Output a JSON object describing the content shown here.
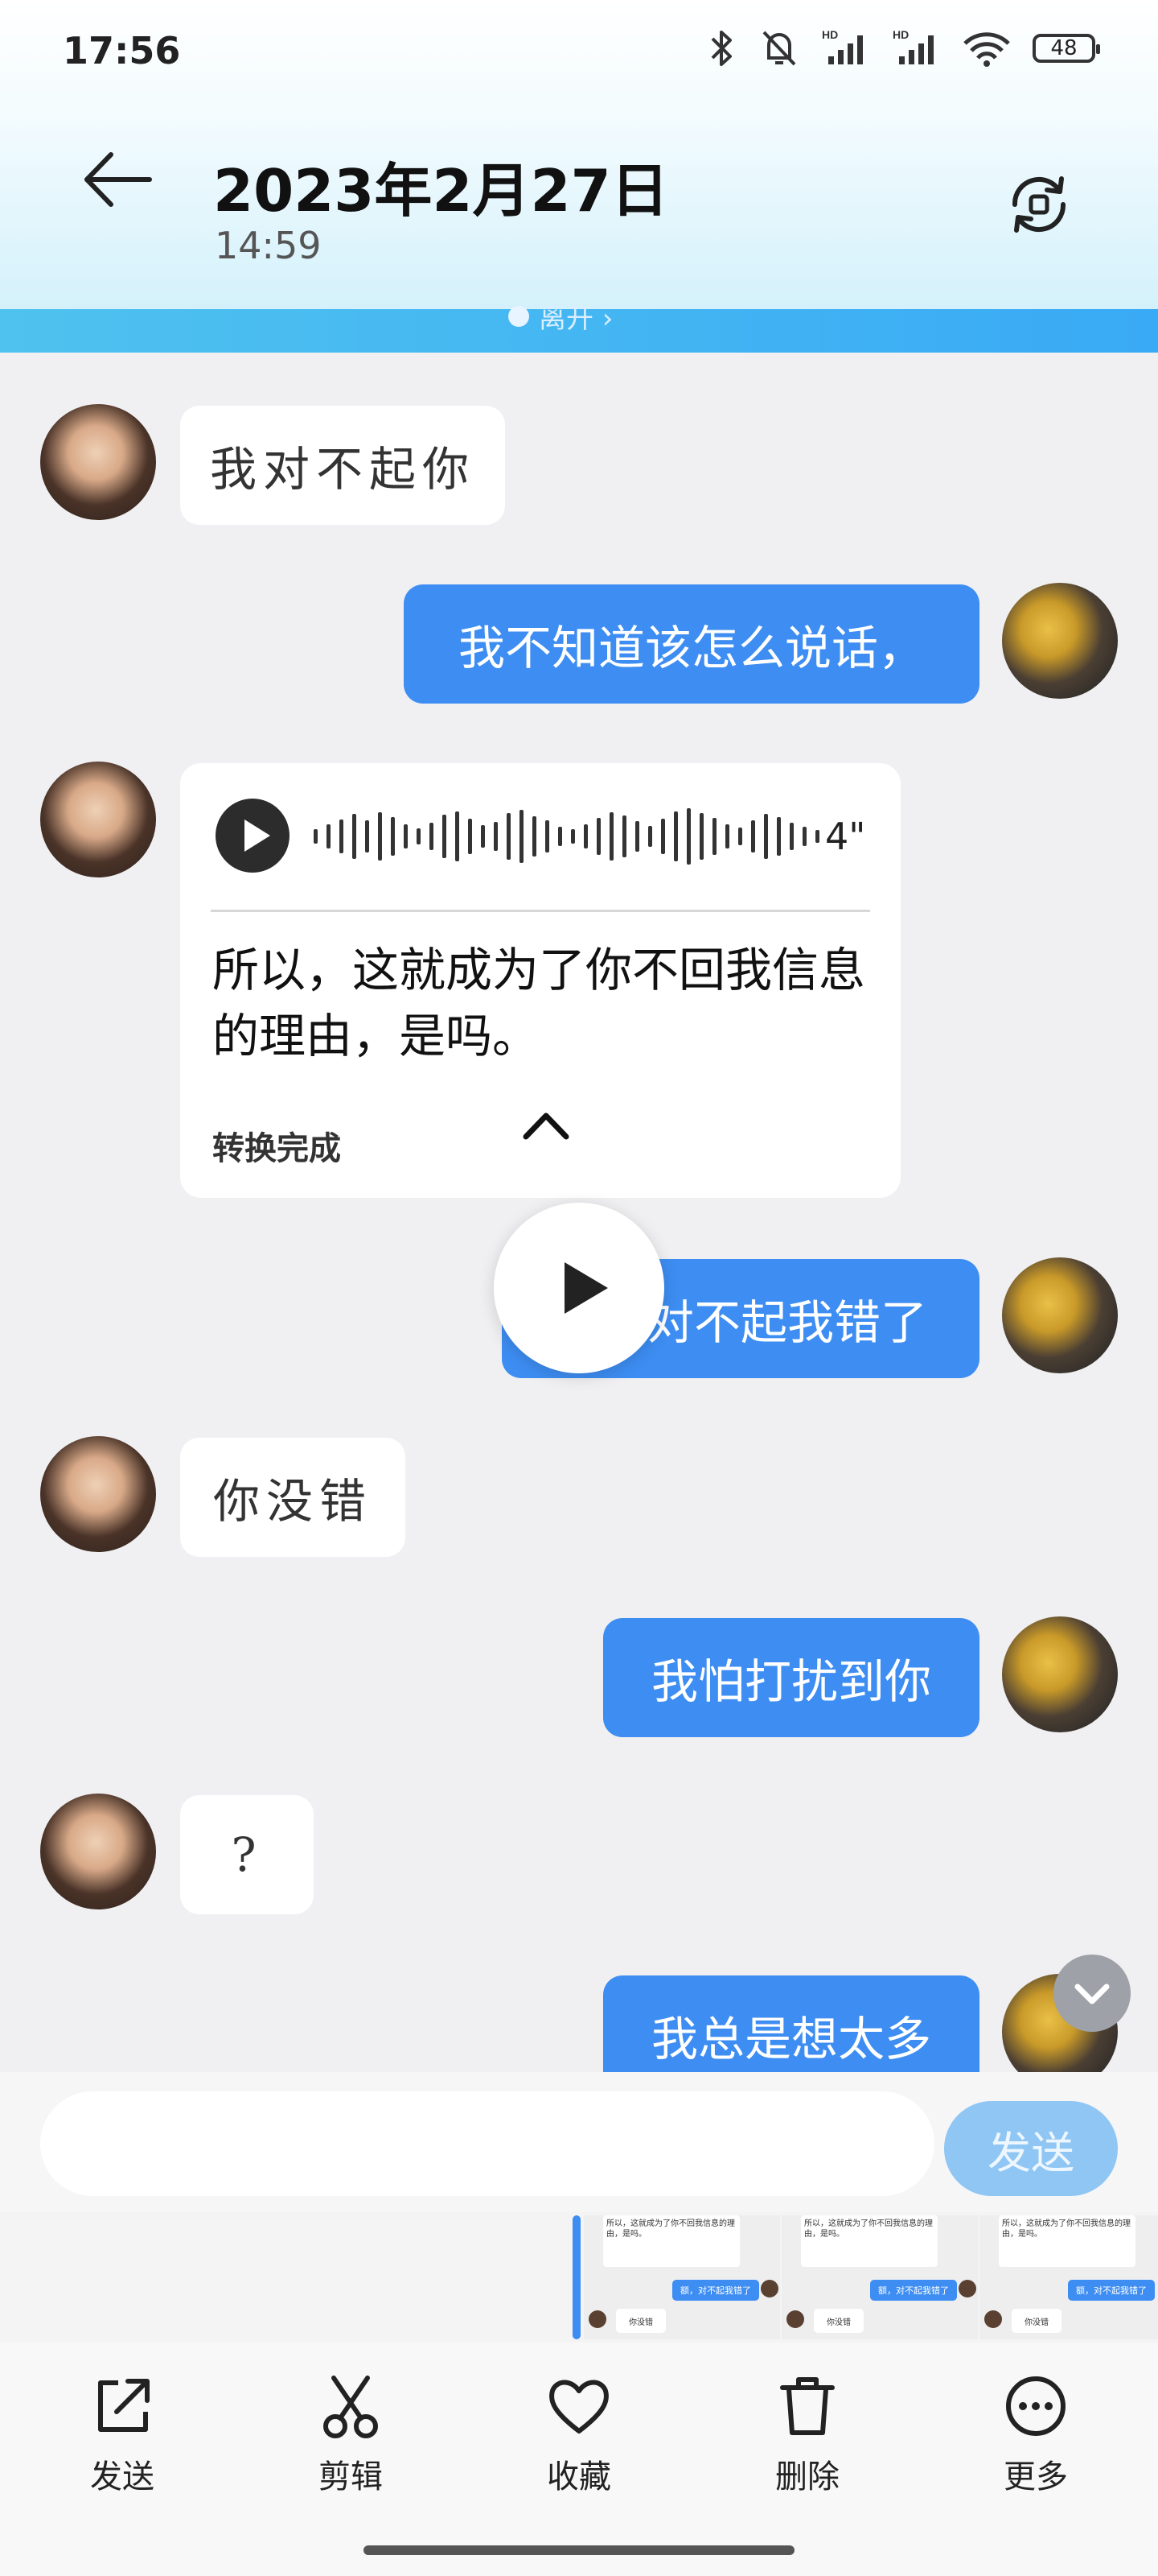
{
  "status_bar": {
    "time": "17:56",
    "battery": "48",
    "icons": [
      "bluetooth-icon",
      "mute-icon",
      "signal-hd-icon",
      "signal-hd-icon",
      "wifi-icon",
      "battery-icon"
    ]
  },
  "header": {
    "title": "2023年2月27日",
    "subtitle": "14:59"
  },
  "chat": {
    "left_notice": "离开 ›",
    "messages": [
      {
        "side": "left",
        "text": "我对不起你"
      },
      {
        "side": "right",
        "text": "我不知道该怎么说话，"
      },
      {
        "side": "left",
        "type": "voice",
        "duration": "4\"",
        "text": "所以，这就成为了你不回我信息的理由，是吗。",
        "status": "转换完成"
      },
      {
        "side": "right",
        "text": "额，对不起我错了"
      },
      {
        "side": "left",
        "text": "你没错"
      },
      {
        "side": "right",
        "text": "我怕打扰到你"
      },
      {
        "side": "left",
        "text": "?"
      },
      {
        "side": "right",
        "text": "我总是想太多"
      }
    ]
  },
  "composer": {
    "placeholder": "",
    "send_label": "发送"
  },
  "thumbnails": {
    "card_text": "所以，这就成为了你不回我信息的理由，是吗。",
    "card_status": "转换完成",
    "blue_text": "额，对不起我错了",
    "white_text": "你没错"
  },
  "toolbar": {
    "items": [
      {
        "label": "发送",
        "icon": "share-icon"
      },
      {
        "label": "剪辑",
        "icon": "scissors-icon"
      },
      {
        "label": "收藏",
        "icon": "heart-icon"
      },
      {
        "label": "删除",
        "icon": "trash-icon"
      },
      {
        "label": "更多",
        "icon": "more-icon"
      }
    ]
  },
  "colors": {
    "accent_blue": "#3d8df2",
    "send_disabled": "#8fc6f4",
    "header_gradient_end": "#d4f1fb"
  }
}
